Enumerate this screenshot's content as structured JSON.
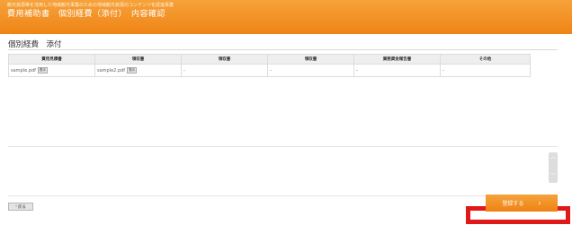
{
  "header": {
    "subtitle": "観光資源等を活用した地域観光事業のための地域観光資源のコンテンツ化促進事業",
    "title": "費用補助書　個別経費（添付）　内容確認"
  },
  "section": {
    "title": "個別経費　添付"
  },
  "table": {
    "columns": [
      "費用見積書",
      "領収書",
      "領収書",
      "領収書",
      "業務資金報告書",
      "その他"
    ],
    "rows": [
      [
        {
          "file": "sample.pdf",
          "view_label": "表示"
        },
        {
          "file": "sample2.pdf",
          "view_label": "表示"
        },
        {
          "text": "-"
        },
        {
          "text": "-"
        },
        {
          "text": "-"
        },
        {
          "text": "-"
        }
      ]
    ]
  },
  "footer": {
    "back_label": "戻る",
    "back_icon": "chevron-left-icon",
    "register_label": "登録する",
    "register_icon": "chevron-right-icon"
  },
  "colors": {
    "header_orange": "#ef8416",
    "button_orange": "#f39a2e",
    "highlight_red": "#e01818"
  }
}
